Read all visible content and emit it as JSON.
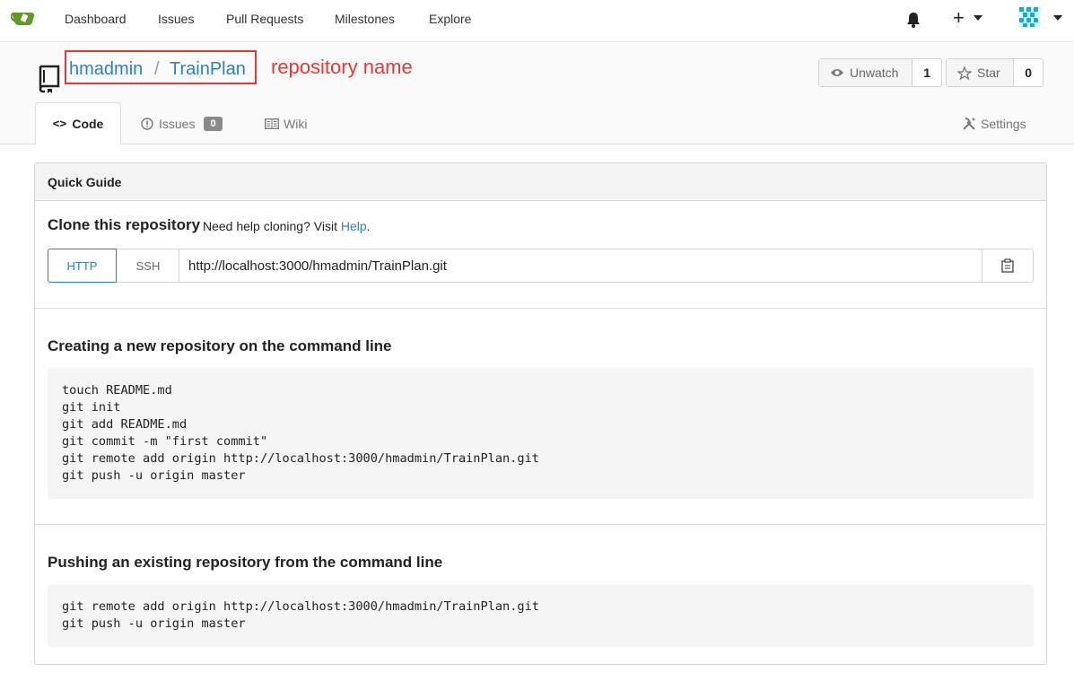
{
  "navbar": {
    "items": [
      "Dashboard",
      "Issues",
      "Pull Requests",
      "Milestones",
      "Explore"
    ]
  },
  "repo": {
    "owner": "hmadmin",
    "separator": "/",
    "name": "TrainPlan",
    "annotation": "repository name",
    "watch_label": "Unwatch",
    "watch_count": "1",
    "star_label": "Star",
    "star_count": "0"
  },
  "tabs": {
    "code": "Code",
    "issues": "Issues",
    "issues_count": "0",
    "wiki": "Wiki",
    "settings": "Settings"
  },
  "guide": {
    "header": "Quick Guide",
    "clone_title": "Clone this repository",
    "clone_help_text": "Need help cloning? Visit",
    "clone_help_link": "Help",
    "clone_help_period": ".",
    "protocol_http": "HTTP",
    "protocol_ssh": "SSH",
    "clone_url": "http://localhost:3000/hmadmin/TrainPlan.git",
    "new_repo_title": "Creating a new repository on the command line",
    "new_repo_code": "touch README.md\ngit init\ngit add README.md\ngit commit -m \"first commit\"\ngit remote add origin http://localhost:3000/hmadmin/TrainPlan.git\ngit push -u origin master",
    "existing_repo_title": "Pushing an existing repository from the command line",
    "existing_repo_code": "git remote add origin http://localhost:3000/hmadmin/TrainPlan.git\ngit push -u origin master"
  },
  "colors": {
    "link": "#2f80c2",
    "annotation": "#e53935",
    "logo": "#609926"
  },
  "icons": [
    "gitea-logo-icon",
    "bell-icon",
    "plus-icon",
    "avatar-icon",
    "repo-book-icon",
    "eye-icon",
    "star-icon",
    "code-icon",
    "issue-icon",
    "wiki-icon",
    "settings-icon",
    "clipboard-icon"
  ]
}
